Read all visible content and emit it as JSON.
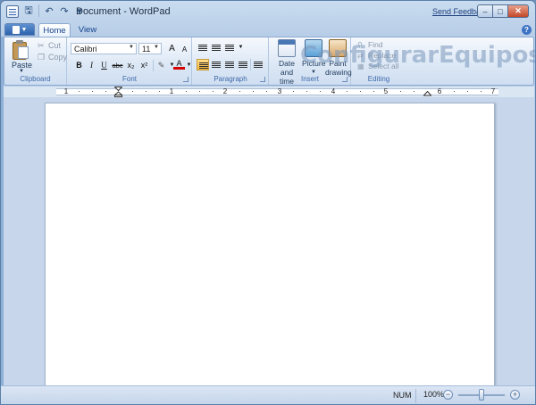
{
  "window": {
    "title": "Document - WordPad",
    "feedback_link": "Send Feedback",
    "controls": {
      "minimize": "–",
      "maximize": "□",
      "close": "✕"
    }
  },
  "quick_access": [
    {
      "name": "save-icon",
      "glyph": "🖫"
    },
    {
      "name": "undo-icon",
      "glyph": "↶"
    },
    {
      "name": "redo-icon",
      "glyph": "↷"
    },
    {
      "name": "customize-arrow-icon",
      "glyph": "▾"
    }
  ],
  "tabs": {
    "home": "Home",
    "view": "View",
    "help": "?"
  },
  "clipboard": {
    "paste": "Paste",
    "cut": "Cut",
    "copy": "Copy",
    "label": "Clipboard"
  },
  "font": {
    "family": "Calibri",
    "size": "11",
    "grow": "A",
    "shrink": "A",
    "bold": "B",
    "italic": "I",
    "underline": "U",
    "strikethrough": "abc",
    "subscript": "x₂",
    "superscript": "x²",
    "label": "Font",
    "highlight_color": "#f7d400",
    "text_color": "#d40000"
  },
  "paragraph": {
    "label": "Paragraph"
  },
  "insert": {
    "date_time_1": "Date and",
    "date_time_2": "time",
    "picture": "Picture",
    "paint_1": "Paint",
    "paint_2": "drawing",
    "label": "Insert"
  },
  "editing": {
    "find": "Find",
    "replace": "Replace",
    "select_all": "Select all",
    "label": "Editing"
  },
  "watermark": "ConfigurarEquipos",
  "ruler": {
    "numbers": [
      "1",
      "1",
      "2",
      "3",
      "4",
      "5",
      "6",
      "7"
    ]
  },
  "statusbar": {
    "num": "NUM",
    "zoom": "100%",
    "zoom_out": "−",
    "zoom_in": "+"
  }
}
